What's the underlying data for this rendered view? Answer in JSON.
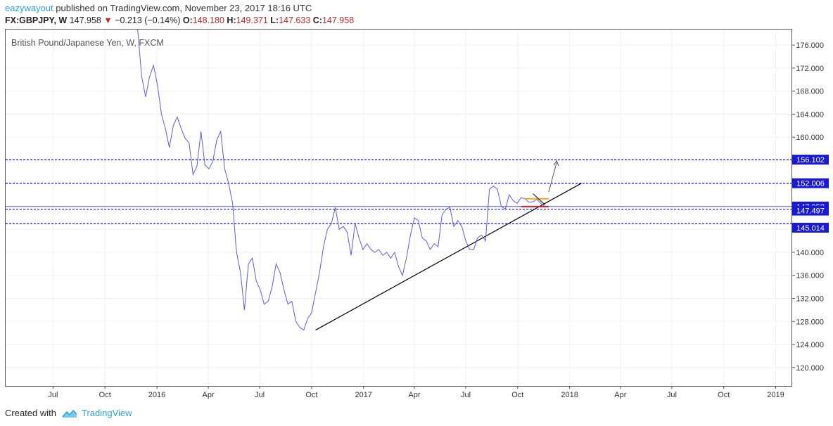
{
  "header": {
    "author": "eazywayout",
    "published_text": "published on TradingView.com, November 23, 2017 18:16 UTC",
    "symbol": "FX:GBPJPY, W",
    "price": "147.958",
    "change": "−0.213 (−0.14%)",
    "o_label": "O:",
    "o_value": "148.180",
    "h_label": "H:",
    "h_value": "149.371",
    "l_label": "L:",
    "l_value": "147.633",
    "c_label": "C:",
    "c_value": "147.958"
  },
  "colors": {
    "series": "#5b5bdc",
    "level_line": "#1a1ad4",
    "trend_line": "#000000",
    "orange_line": "#f5a623",
    "red_line": "#e02020"
  },
  "chart_data": {
    "type": "line",
    "title": "British Pound/Japanese Yen, W, FXCM",
    "xlabel": "",
    "ylabel": "",
    "ylim": [
      116.8,
      178.7
    ],
    "grid": true,
    "x_ticks": [
      "Jul",
      "Oct",
      "2016",
      "Apr",
      "Jul",
      "Oct",
      "2017",
      "Apr",
      "Jul",
      "Oct",
      "2018",
      "Apr",
      "Jul",
      "Oct",
      "2019"
    ],
    "y_ticks": [
      "176.000",
      "172.000",
      "168.000",
      "164.000",
      "160.000",
      "156.000",
      "152.000",
      "148.000",
      "144.000",
      "140.000",
      "136.000",
      "132.000",
      "128.000",
      "124.000",
      "120.000"
    ],
    "series": [
      {
        "x": [
          "2015-11-21",
          "2015-11-28",
          "2015-12-05",
          "2015-12-12",
          "2015-12-19",
          "2015-12-26",
          "2016-01-02",
          "2016-01-09",
          "2016-01-16",
          "2016-01-23",
          "2016-01-30",
          "2016-02-06",
          "2016-02-13",
          "2016-02-20",
          "2016-02-27",
          "2016-03-05",
          "2016-03-12",
          "2016-03-19",
          "2016-03-26",
          "2016-04-02",
          "2016-04-09",
          "2016-04-16",
          "2016-04-23",
          "2016-04-30",
          "2016-05-07",
          "2016-05-14",
          "2016-05-21",
          "2016-05-28",
          "2016-06-04",
          "2016-06-11",
          "2016-06-18",
          "2016-06-25",
          "2016-07-02",
          "2016-07-09",
          "2016-07-16",
          "2016-07-23",
          "2016-07-30",
          "2016-08-06",
          "2016-08-13",
          "2016-08-20",
          "2016-08-27",
          "2016-09-03",
          "2016-09-10",
          "2016-09-17",
          "2016-09-24",
          "2016-10-01",
          "2016-10-08",
          "2016-10-15",
          "2016-10-22",
          "2016-10-29",
          "2016-11-05",
          "2016-11-12",
          "2016-11-19",
          "2016-11-26",
          "2016-12-03",
          "2016-12-10",
          "2016-12-17",
          "2016-12-24",
          "2016-12-31",
          "2017-01-07",
          "2017-01-14",
          "2017-01-21",
          "2017-01-28",
          "2017-02-04",
          "2017-02-11",
          "2017-02-18",
          "2017-02-25",
          "2017-03-04",
          "2017-03-11",
          "2017-03-18",
          "2017-03-25",
          "2017-04-01",
          "2017-04-08",
          "2017-04-15",
          "2017-04-22",
          "2017-04-29",
          "2017-05-06",
          "2017-05-13",
          "2017-05-20",
          "2017-05-27",
          "2017-06-03",
          "2017-06-10",
          "2017-06-17",
          "2017-06-24",
          "2017-07-01",
          "2017-07-08",
          "2017-07-15",
          "2017-07-22",
          "2017-07-29",
          "2017-08-05",
          "2017-08-12",
          "2017-08-19",
          "2017-08-26",
          "2017-09-02",
          "2017-09-09",
          "2017-09-16",
          "2017-09-23",
          "2017-09-30",
          "2017-10-07",
          "2017-10-14",
          "2017-10-21",
          "2017-10-28",
          "2017-11-04",
          "2017-11-11",
          "2017-11-18"
        ],
        "y": [
          180.8,
          178.5,
          170.5,
          167.0,
          170.5,
          172.5,
          169.0,
          164.0,
          161.5,
          158.2,
          162.0,
          163.5,
          161.5,
          159.8,
          159.0,
          153.5,
          155.0,
          161.0,
          155.2,
          154.5,
          155.8,
          159.5,
          161.0,
          154.5,
          152.0,
          148.5,
          140.0,
          136.5,
          130.0,
          138.0,
          139.0,
          135.0,
          133.5,
          131.0,
          131.5,
          134.0,
          138.0,
          136.5,
          133.5,
          131.0,
          131.5,
          128.0,
          127.0,
          126.5,
          128.5,
          129.5,
          133.0,
          136.5,
          141.0,
          144.0,
          145.0,
          147.8,
          144.0,
          144.5,
          143.5,
          139.5,
          145.0,
          142.5,
          140.5,
          141.5,
          140.5,
          140.0,
          140.5,
          139.5,
          140.0,
          139.0,
          140.0,
          137.5,
          136.0,
          139.0,
          143.0,
          146.0,
          145.5,
          142.5,
          142.0,
          140.5,
          141.5,
          141.0,
          146.5,
          147.5,
          147.8,
          144.5,
          145.5,
          144.5,
          142.0,
          140.5,
          140.5,
          142.5,
          143.0,
          142.0,
          151.0,
          151.5,
          151.0,
          148.0,
          147.5,
          150.0,
          149.0,
          148.5,
          149.5,
          149.3,
          148.7,
          148.8,
          149.2,
          148.5,
          147.958
        ]
      }
    ],
    "levels": [
      156.102,
      152.006,
      147.958,
      147.497,
      145.014
    ],
    "level_labels": [
      "156.102",
      "152.006",
      "147.958",
      "147.497",
      "145.014"
    ]
  },
  "footer": {
    "created_with": "Created with",
    "brand": "TradingView"
  }
}
